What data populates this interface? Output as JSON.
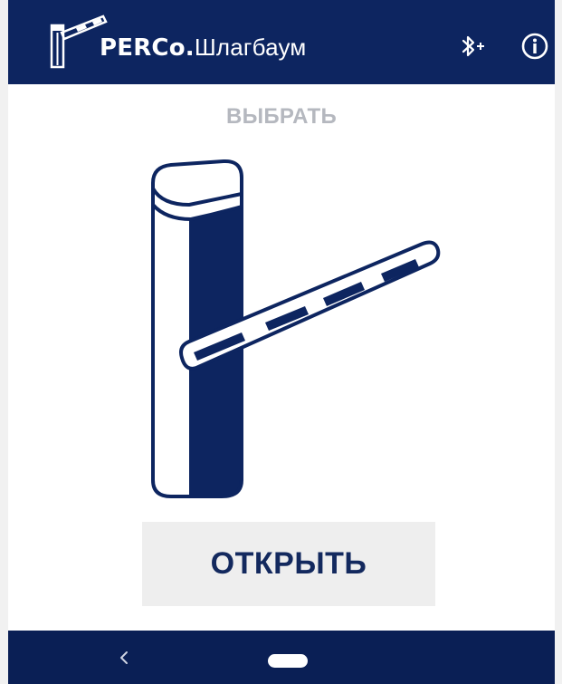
{
  "app_bar": {
    "brand": "PERCo.",
    "product": "Шлагбаум",
    "logo_icon": "barrier-logo-icon",
    "bluetooth_icon": "bluetooth-add-icon",
    "info_icon": "info-icon",
    "background_color": "#0d2560"
  },
  "main": {
    "select_label": "ВЫБРАТЬ",
    "illustration_icon": "barrier-gate-icon",
    "open_button_label": "ОТКРЫТЬ",
    "accent_color": "#13295e"
  },
  "nav_bar": {
    "back_icon": "back-chevron-icon",
    "home_icon": "home-pill-icon"
  }
}
